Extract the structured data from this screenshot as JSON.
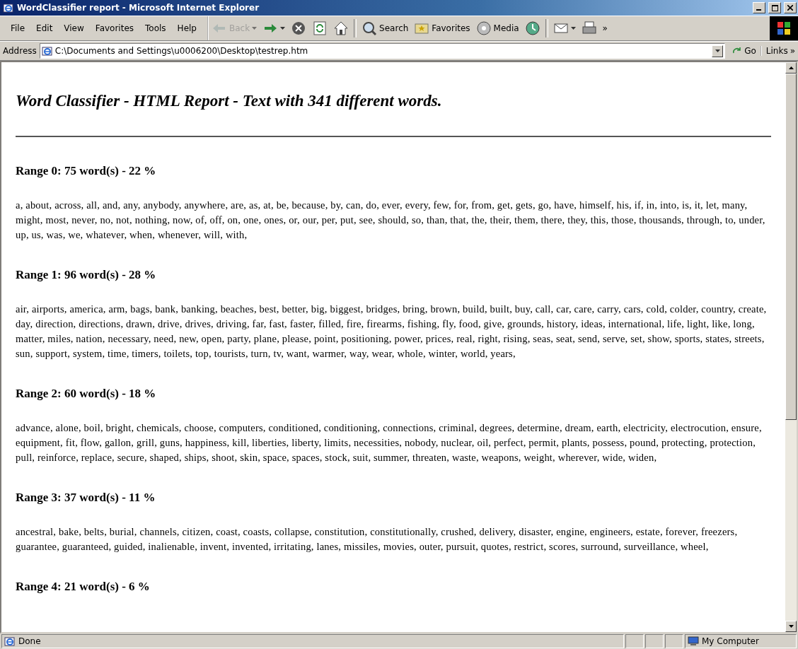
{
  "window": {
    "title": "WordClassifier report - Microsoft Internet Explorer"
  },
  "menu": [
    "File",
    "Edit",
    "View",
    "Favorites",
    "Tools",
    "Help"
  ],
  "toolbar": [
    {
      "kind": "back",
      "label": "Back",
      "disabled": true
    },
    {
      "kind": "forward",
      "disabled": false
    },
    {
      "kind": "stop",
      "disabled": false
    },
    {
      "kind": "refresh",
      "disabled": false
    },
    {
      "kind": "home",
      "disabled": false
    },
    {
      "kind": "search",
      "label": "Search",
      "disabled": false
    },
    {
      "kind": "favorites",
      "label": "Favorites",
      "disabled": false
    },
    {
      "kind": "media",
      "label": "Media",
      "disabled": false
    },
    {
      "kind": "history",
      "disabled": false
    },
    {
      "kind": "mail",
      "disabled": false
    },
    {
      "kind": "print",
      "disabled": false
    },
    {
      "kind": "more",
      "label": "»",
      "disabled": false
    }
  ],
  "address": {
    "label": "Address",
    "value": "C:\\Documents and Settings\\u0006200\\Desktop\\testrep.htm",
    "go": "Go",
    "links": "Links",
    "more": "»"
  },
  "report": {
    "title": "Word Classifier - HTML Report - Text with 341 different words.",
    "ranges": [
      {
        "heading": "Range 0: 75 word(s) - 22 %",
        "words": "a, about, across, all, and, any, anybody, anywhere, are, as, at, be, because, by, can, do, ever, every, few, for, from, get, gets, go, have, himself, his, if, in, into, is, it, let, many, might, most, never, no, not, nothing, now, of, off, on, one, ones, or, our, per, put, see, should, so, than, that, the, their, them, there, they, this, those, thousands, through, to, under, up, us, was, we, whatever, when, whenever, will, with,"
      },
      {
        "heading": "Range 1: 96 word(s) - 28 %",
        "words": "air, airports, america, arm, bags, bank, banking, beaches, best, better, big, biggest, bridges, bring, brown, build, built, buy, call, car, care, carry, cars, cold, colder, country, create, day, direction, directions, drawn, drive, drives, driving, far, fast, faster, filled, fire, firearms, fishing, fly, food, give, grounds, history, ideas, international, life, light, like, long, matter, miles, nation, necessary, need, new, open, party, plane, please, point, positioning, power, prices, real, right, rising, seas, seat, send, serve, set, show, sports, states, streets, sun, support, system, time, timers, toilets, top, tourists, turn, tv, want, warmer, way, wear, whole, winter, world, years,"
      },
      {
        "heading": "Range 2: 60 word(s) - 18 %",
        "words": "advance, alone, boil, bright, chemicals, choose, computers, conditioned, conditioning, connections, criminal, degrees, determine, dream, earth, electricity, electrocution, ensure, equipment, fit, flow, gallon, grill, guns, happiness, kill, liberties, liberty, limits, necessities, nobody, nuclear, oil, perfect, permit, plants, possess, pound, protecting, protection, pull, reinforce, replace, secure, shaped, ships, shoot, skin, space, spaces, stock, suit, summer, threaten, waste, weapons, weight, wherever, wide, widen,"
      },
      {
        "heading": "Range 3: 37 word(s) - 11 %",
        "words": "ancestral, bake, belts, burial, channels, citizen, coast, coasts, collapse, constitution, constitutionally, crushed, delivery, disaster, engine, engineers, estate, forever, freezers, guarantee, guaranteed, guided, inalienable, invent, invented, irritating, lanes, missiles, movies, outer, pursuit, quotes, restrict, scores, surround, surveillance, wheel,"
      },
      {
        "heading": "Range 4: 21 word(s) - 6 %"
      }
    ]
  },
  "status_bar": {
    "text": "Done",
    "zone": "My Computer"
  }
}
